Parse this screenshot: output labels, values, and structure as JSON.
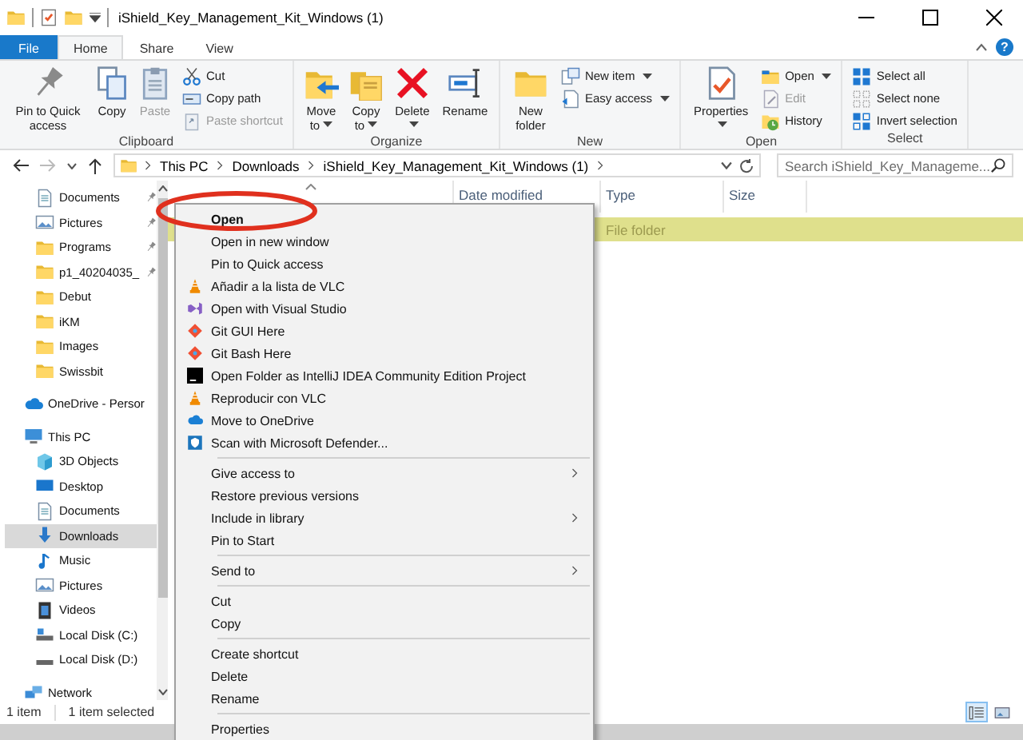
{
  "window": {
    "title": "iShield_Key_Management_Kit_Windows (1)"
  },
  "ribbon_tabs": [
    {
      "label": "File",
      "kind": "menu",
      "selected": false
    },
    {
      "label": "Home",
      "kind": "tab",
      "selected": true
    },
    {
      "label": "Share",
      "kind": "tab",
      "selected": false
    },
    {
      "label": "View",
      "kind": "tab",
      "selected": false
    }
  ],
  "help": "?",
  "ribbon_groups": [
    {
      "label": "Clipboard",
      "large": [
        {
          "label": "Pin to Quick access",
          "dropdown": false,
          "disabled": false
        },
        {
          "label": "Copy",
          "dropdown": false,
          "disabled": false
        },
        {
          "label": "Paste",
          "dropdown": false,
          "disabled": true
        }
      ],
      "small": [
        {
          "label": "Cut",
          "dropdown": false,
          "disabled": false
        },
        {
          "label": "Copy path",
          "dropdown": false,
          "disabled": false
        },
        {
          "label": "Paste shortcut",
          "dropdown": false,
          "disabled": true
        }
      ]
    },
    {
      "label": "Organize",
      "large": [
        {
          "label": "Move to",
          "dropdown": true,
          "disabled": false
        },
        {
          "label": "Copy to",
          "dropdown": true,
          "disabled": false
        },
        {
          "label": "Delete",
          "dropdown": true,
          "disabled": false
        },
        {
          "label": "Rename",
          "dropdown": false,
          "disabled": false
        }
      ]
    },
    {
      "label": "New",
      "large": [
        {
          "label": "New folder",
          "dropdown": false,
          "disabled": false
        }
      ],
      "small": [
        {
          "label": "New item",
          "dropdown": true,
          "disabled": false
        },
        {
          "label": "Easy access",
          "dropdown": true,
          "disabled": false
        }
      ]
    },
    {
      "label": "Open",
      "large": [
        {
          "label": "Properties",
          "dropdown": true,
          "disabled": false
        }
      ],
      "small": [
        {
          "label": "Open",
          "dropdown": true,
          "disabled": false
        },
        {
          "label": "Edit",
          "dropdown": false,
          "disabled": true
        },
        {
          "label": "History",
          "dropdown": false,
          "disabled": false
        }
      ]
    },
    {
      "label": "Select",
      "small": [
        {
          "label": "Select all",
          "dropdown": false,
          "disabled": false
        },
        {
          "label": "Select none",
          "dropdown": false,
          "disabled": false
        },
        {
          "label": "Invert selection",
          "dropdown": false,
          "disabled": false
        }
      ]
    }
  ],
  "address_bar": {
    "crumbs": [
      "This PC",
      "Downloads",
      "iShield_Key_Management_Kit_Windows (1)"
    ]
  },
  "search": {
    "placeholder": "Search iShield_Key_Manageme..."
  },
  "nav": {
    "quick_access": [
      {
        "label": "Documents",
        "pinned": true,
        "selected": false
      },
      {
        "label": "Pictures",
        "pinned": true,
        "selected": false
      },
      {
        "label": "Programs",
        "pinned": true,
        "selected": false
      },
      {
        "label": "p1_40204035_",
        "pinned": true,
        "selected": false
      },
      {
        "label": "Debut",
        "pinned": false,
        "selected": false
      },
      {
        "label": "iKM",
        "pinned": false,
        "selected": false
      },
      {
        "label": "Images",
        "pinned": false,
        "selected": false
      },
      {
        "label": "Swissbit",
        "pinned": false,
        "selected": false
      }
    ],
    "locations": [
      {
        "label": "OneDrive - Persor",
        "selected": false
      },
      {
        "label": "This PC",
        "selected": false,
        "children": [
          {
            "label": "3D Objects",
            "selected": false
          },
          {
            "label": "Desktop",
            "selected": false
          },
          {
            "label": "Documents",
            "selected": false
          },
          {
            "label": "Downloads",
            "selected": true
          },
          {
            "label": "Music",
            "selected": false
          },
          {
            "label": "Pictures",
            "selected": false
          },
          {
            "label": "Videos",
            "selected": false
          },
          {
            "label": "Local Disk (C:)",
            "selected": false
          },
          {
            "label": "Local Disk (D:)",
            "selected": false
          }
        ]
      },
      {
        "label": "Network",
        "selected": false
      }
    ]
  },
  "columns": [
    {
      "label": "Date modified"
    },
    {
      "label": "Type"
    },
    {
      "label": "Size"
    }
  ],
  "rows": [
    {
      "type": "File folder",
      "selected": true
    }
  ],
  "context_menu": {
    "sections": [
      [
        {
          "label": "Open",
          "default": true,
          "submenu": false
        },
        {
          "label": "Open in new window",
          "default": false,
          "submenu": false
        },
        {
          "label": "Pin to Quick access",
          "default": false,
          "submenu": false
        },
        {
          "label": "Añadir a la lista de VLC",
          "default": false,
          "submenu": false
        },
        {
          "label": "Open with Visual Studio",
          "default": false,
          "submenu": false
        },
        {
          "label": "Git GUI Here",
          "default": false,
          "submenu": false
        },
        {
          "label": "Git Bash Here",
          "default": false,
          "submenu": false
        },
        {
          "label": "Open Folder as IntelliJ IDEA Community Edition Project",
          "default": false,
          "submenu": false
        },
        {
          "label": "Reproducir con VLC",
          "default": false,
          "submenu": false
        },
        {
          "label": "Move to OneDrive",
          "default": false,
          "submenu": false
        },
        {
          "label": "Scan with Microsoft Defender...",
          "default": false,
          "submenu": false
        }
      ],
      [
        {
          "label": "Give access to",
          "default": false,
          "submenu": true
        },
        {
          "label": "Restore previous versions",
          "default": false,
          "submenu": false
        },
        {
          "label": "Include in library",
          "default": false,
          "submenu": true
        },
        {
          "label": "Pin to Start",
          "default": false,
          "submenu": false
        }
      ],
      [
        {
          "label": "Send to",
          "default": false,
          "submenu": true
        }
      ],
      [
        {
          "label": "Cut",
          "default": false,
          "submenu": false
        },
        {
          "label": "Copy",
          "default": false,
          "submenu": false
        }
      ],
      [
        {
          "label": "Create shortcut",
          "default": false,
          "submenu": false
        },
        {
          "label": "Delete",
          "default": false,
          "submenu": false
        },
        {
          "label": "Rename",
          "default": false,
          "submenu": false
        }
      ],
      [
        {
          "label": "Properties",
          "default": false,
          "submenu": false
        }
      ]
    ]
  },
  "status_bar": {
    "item_count": "1 item",
    "selection": "1 item selected",
    "views": [
      {
        "selected": true
      },
      {
        "selected": false
      }
    ]
  }
}
